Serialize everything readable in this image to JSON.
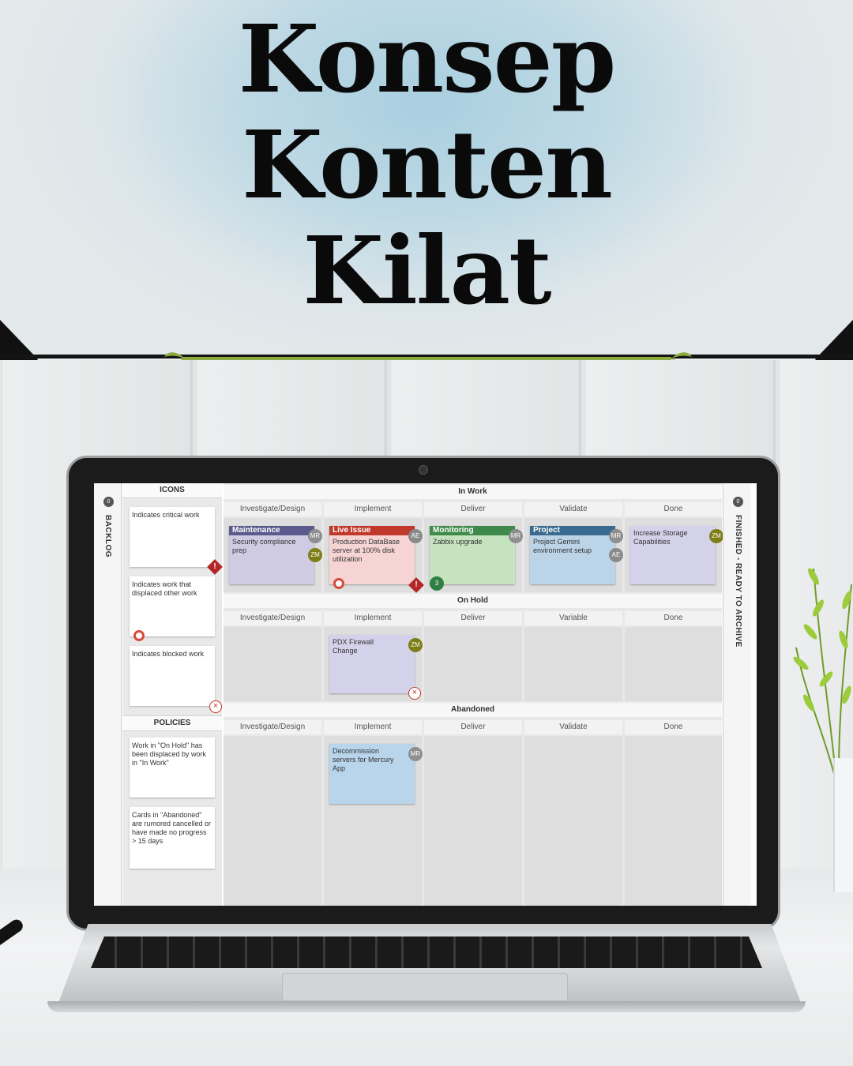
{
  "poster": {
    "title_lines": [
      "Konsep",
      "Konten",
      "Kilat"
    ]
  },
  "kanban": {
    "left_lane_label": "BACKLOG",
    "left_lane_count": "0",
    "right_lane_label": "FINISHED - READY TO ARCHIVE",
    "right_lane_count": "0",
    "icons_header": "ICONS",
    "icon_notes": [
      "Indicates critical work",
      "Indicates work that displaced other work",
      "Indicates blocked work"
    ],
    "policies_header": "POLICIES",
    "policy_notes": [
      "Work in \"On Hold\" has been displaced by work in \"In Work\"",
      "Cards in \"Abandoned\" are rumored cancelled or have made no progress > 15 days"
    ],
    "sections": [
      {
        "title": "In Work",
        "columns": [
          "Investigate/Design",
          "Implement",
          "Deliver",
          "Validate",
          "Done"
        ]
      },
      {
        "title": "On Hold",
        "columns": [
          "Investigate/Design",
          "Implement",
          "Deliver",
          "Variable",
          "Done"
        ]
      },
      {
        "title": "Abandoned",
        "columns": [
          "Investigate/Design",
          "Implement",
          "Deliver",
          "Validate",
          "Done"
        ]
      }
    ],
    "cards": {
      "maintenance": {
        "type": "Maintenance",
        "text": "Security compliance prep",
        "avatars": [
          "MR",
          "ZM"
        ]
      },
      "live_issue": {
        "type": "Live Issue",
        "text": "Production DataBase server at 100% disk utilization",
        "avatars": [
          "AE"
        ]
      },
      "monitoring": {
        "type": "Monitoring",
        "text": "Zabbix upgrade",
        "avatars": [
          "MR"
        ],
        "badge": "3"
      },
      "project": {
        "type": "Project",
        "text": "Project Gemini environment setup",
        "avatars": [
          "MR",
          "AE"
        ]
      },
      "storage": {
        "text": "Increase Storage Capabilities",
        "avatars": [
          "ZM"
        ]
      },
      "pdx": {
        "text": "PDX Firewall Change",
        "avatars": [
          "ZM"
        ]
      },
      "decommission": {
        "text": "Decommission servers for Mercury App",
        "avatars": [
          "MR"
        ]
      }
    },
    "colors": {
      "maintenance": "#5a5a8c",
      "live_issue": "#c0392b",
      "monitoring": "#3f8a4a",
      "project": "#3a6a8f",
      "critical": "#b52626"
    }
  }
}
